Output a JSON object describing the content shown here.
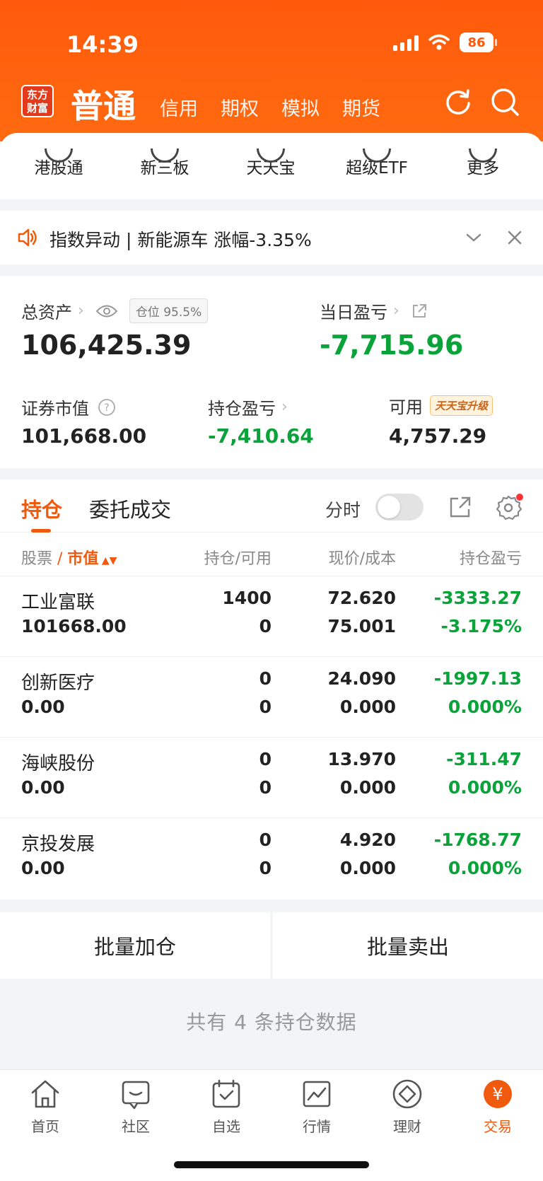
{
  "status": {
    "time": "14:39",
    "battery": "86"
  },
  "header": {
    "logo_text": "东方财富",
    "active_tab": "普通",
    "tabs": [
      "信用",
      "期权",
      "模拟",
      "期货"
    ]
  },
  "quick_menu": [
    "港股通",
    "新三板",
    "天天宝",
    "超级ETF",
    "更多"
  ],
  "notice": {
    "text": "指数异动 | 新能源车 涨幅-3.35%"
  },
  "assets": {
    "total_label": "总资产",
    "position_badge": "仓位 95.5%",
    "total_value": "106,425.39",
    "daily_pl_label": "当日盈亏",
    "daily_pl_value": "-7,715.96",
    "market_value_label": "证券市值",
    "market_value": "101,668.00",
    "holding_pl_label": "持仓盈亏",
    "holding_pl_value": "-7,410.64",
    "available_label": "可用",
    "ttb_badge": "天天宝升级",
    "available_value": "4,757.29"
  },
  "holdings": {
    "tab_active": "持仓",
    "tab_other": "委托成交",
    "fenshi_label": "分时",
    "columns": {
      "stock": "股票",
      "market_value": "市值",
      "position": "持仓/可用",
      "price": "现价/成本",
      "pl": "持仓盈亏"
    },
    "rows": [
      {
        "name": "工业富联",
        "mv": "101668.00",
        "pos": "1400",
        "avail": "0",
        "price": "72.620",
        "cost": "75.001",
        "pl": "-3333.27",
        "pct": "-3.175%"
      },
      {
        "name": "创新医疗",
        "mv": "0.00",
        "pos": "0",
        "avail": "0",
        "price": "24.090",
        "cost": "0.000",
        "pl": "-1997.13",
        "pct": "0.000%"
      },
      {
        "name": "海峡股份",
        "mv": "0.00",
        "pos": "0",
        "avail": "0",
        "price": "13.970",
        "cost": "0.000",
        "pl": "-311.47",
        "pct": "0.000%"
      },
      {
        "name": "京投发展",
        "mv": "0.00",
        "pos": "0",
        "avail": "0",
        "price": "4.920",
        "cost": "0.000",
        "pl": "-1768.77",
        "pct": "0.000%"
      }
    ]
  },
  "actions": {
    "batch_add": "批量加仓",
    "batch_sell": "批量卖出"
  },
  "summary": "共有 4 条持仓数据",
  "tabbar": {
    "items": [
      "首页",
      "社区",
      "自选",
      "行情",
      "理财",
      "交易"
    ],
    "trade_symbol": "¥"
  },
  "colors": {
    "accent": "#ef5a0e",
    "down": "#0aa33a",
    "header": "#ff5a0b"
  }
}
